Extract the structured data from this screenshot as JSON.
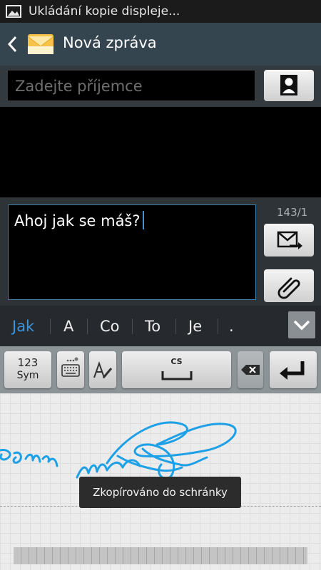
{
  "status_bar": {
    "notification": "Ukládání kopie displeje...",
    "icon": "image-icon"
  },
  "app_bar": {
    "title": "Nová zpráva",
    "back_icon": "chevron-left-icon",
    "app_icon": "envelope-icon"
  },
  "recipient": {
    "placeholder": "Zadejte příjemce",
    "contact_button_icon": "contact-icon"
  },
  "message": {
    "text": "Ahoj jak se máš?",
    "char_counter": "143/1",
    "send_icon": "send-icon",
    "attach_icon": "paperclip-icon"
  },
  "suggestions": [
    "Jak",
    "A",
    "Co",
    "To",
    "Je",
    "."
  ],
  "suggestion_highlight_color": "#3e93d9",
  "keyboard": {
    "sym_line1": "123",
    "sym_line2": "Sym",
    "keyboard_icon": "keyboard-icon",
    "pen_icon": "handwriting-icon",
    "space_label": "CS",
    "backspace_icon": "backspace-icon",
    "enter_icon": "enter-icon",
    "collapse_icon": "chevron-down-icon"
  },
  "toast": "Zkopírováno do schránky",
  "handwriting_color": "#1ea0e6"
}
